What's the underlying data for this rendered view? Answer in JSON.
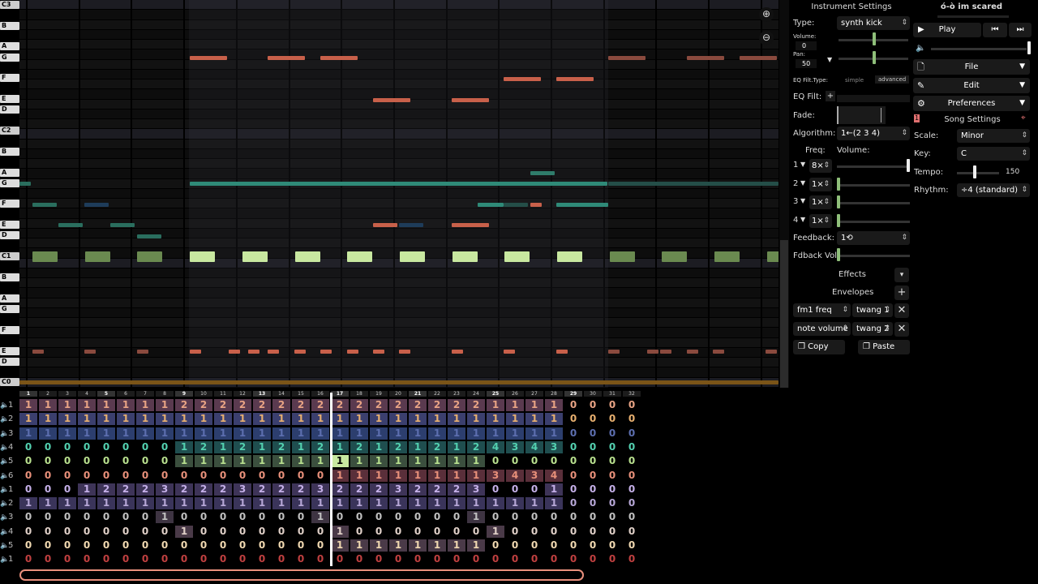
{
  "piano_keys": [
    "C3",
    "B",
    "A",
    "G",
    "F",
    "E",
    "D",
    "C2",
    "B",
    "A",
    "G",
    "F",
    "E",
    "D",
    "C1",
    "B",
    "A",
    "G",
    "F",
    "E",
    "D",
    "C0"
  ],
  "zoom": {
    "in_icon": "zoom-in-icon",
    "out_icon": "zoom-out-icon"
  },
  "bar_numbers": [
    "1",
    "2",
    "3",
    "4",
    "5",
    "6",
    "7",
    "8",
    "9",
    "10",
    "11",
    "12",
    "13",
    "14",
    "15",
    "16",
    "17",
    "18",
    "19",
    "20",
    "21",
    "22",
    "23",
    "24",
    "25",
    "26",
    "27",
    "28",
    "29",
    "30",
    "31",
    "32"
  ],
  "channels": [
    {
      "label": "1",
      "color": "#e8a384",
      "bg": "#5a3a4f",
      "cells": [
        "1",
        "1",
        "1",
        "1",
        "1",
        "1",
        "1",
        "1",
        "2",
        "2",
        "2",
        "2",
        "2",
        "2",
        "2",
        "2",
        "2",
        "2",
        "2",
        "2",
        "2",
        "2",
        "2",
        "2",
        "1",
        "1",
        "1",
        "1",
        "0",
        "0",
        "0",
        "0"
      ]
    },
    {
      "label": "2",
      "color": "#e8b070",
      "bg": "#3b3f6e",
      "cells": [
        "1",
        "1",
        "1",
        "1",
        "1",
        "1",
        "1",
        "1",
        "1",
        "1",
        "1",
        "1",
        "1",
        "1",
        "1",
        "1",
        "1",
        "1",
        "1",
        "1",
        "1",
        "1",
        "1",
        "1",
        "1",
        "1",
        "1",
        "1",
        "0",
        "0",
        "0",
        "0"
      ]
    },
    {
      "label": "3",
      "color": "#5d6fb0",
      "bg": "#2c3e6e",
      "cells": [
        "1",
        "1",
        "1",
        "1",
        "1",
        "1",
        "1",
        "1",
        "1",
        "1",
        "1",
        "1",
        "1",
        "1",
        "1",
        "1",
        "1",
        "1",
        "1",
        "1",
        "1",
        "1",
        "1",
        "1",
        "1",
        "1",
        "1",
        "1",
        "0",
        "0",
        "0",
        "0"
      ]
    },
    {
      "label": "4",
      "color": "#53d1b0",
      "bg": "#1f4e4f",
      "cells": [
        "0",
        "0",
        "0",
        "0",
        "0",
        "0",
        "0",
        "0",
        "1",
        "2",
        "1",
        "2",
        "1",
        "2",
        "1",
        "2",
        "1",
        "2",
        "1",
        "2",
        "1",
        "2",
        "1",
        "2",
        "4",
        "3",
        "4",
        "3",
        "0",
        "0",
        "0",
        "0"
      ]
    },
    {
      "label": "5",
      "color": "#b8e08e",
      "bg": "#3b4f3e",
      "cells": [
        "0",
        "0",
        "0",
        "0",
        "0",
        "0",
        "0",
        "0",
        "1",
        "1",
        "1",
        "1",
        "1",
        "1",
        "1",
        "1",
        "1",
        "1",
        "1",
        "1",
        "1",
        "1",
        "1",
        "1",
        "0",
        "0",
        "0",
        "0",
        "0",
        "0",
        "0",
        "0"
      ]
    },
    {
      "label": "6",
      "color": "#e8907a",
      "bg": "#5a2f3a",
      "cells": [
        "0",
        "0",
        "0",
        "0",
        "0",
        "0",
        "0",
        "0",
        "0",
        "0",
        "0",
        "0",
        "0",
        "0",
        "0",
        "0",
        "1",
        "1",
        "1",
        "1",
        "1",
        "1",
        "1",
        "1",
        "3",
        "4",
        "3",
        "4",
        "0",
        "0",
        "0",
        "0"
      ]
    },
    {
      "label": "1",
      "color": "#c5b0e8",
      "bg": "#3e3458",
      "cells": [
        "0",
        "0",
        "0",
        "1",
        "2",
        "2",
        "2",
        "3",
        "2",
        "2",
        "2",
        "3",
        "2",
        "2",
        "2",
        "3",
        "2",
        "2",
        "2",
        "3",
        "2",
        "2",
        "2",
        "3",
        "0",
        "0",
        "0",
        "1",
        "0",
        "0",
        "0",
        "0"
      ]
    },
    {
      "label": "2",
      "color": "#b8a8d8",
      "bg": "#3a345a",
      "cells": [
        "1",
        "1",
        "1",
        "1",
        "1",
        "1",
        "1",
        "1",
        "1",
        "1",
        "1",
        "1",
        "1",
        "1",
        "1",
        "1",
        "1",
        "1",
        "1",
        "1",
        "1",
        "1",
        "1",
        "1",
        "1",
        "1",
        "1",
        "1",
        "0",
        "0",
        "0",
        "0"
      ]
    },
    {
      "label": "3",
      "color": "#c0c0c0",
      "bg": "#3e3442",
      "cells": [
        "0",
        "0",
        "0",
        "0",
        "0",
        "0",
        "0",
        "1",
        "0",
        "0",
        "0",
        "0",
        "0",
        "0",
        "0",
        "1",
        "0",
        "0",
        "0",
        "0",
        "0",
        "0",
        "0",
        "1",
        "0",
        "0",
        "0",
        "0",
        "0",
        "0",
        "0",
        "0"
      ]
    },
    {
      "label": "4",
      "color": "#e0d0c8",
      "bg": "#4a3a48",
      "cells": [
        "0",
        "0",
        "0",
        "0",
        "0",
        "0",
        "0",
        "0",
        "1",
        "0",
        "0",
        "0",
        "0",
        "0",
        "0",
        "0",
        "1",
        "0",
        "0",
        "0",
        "0",
        "0",
        "0",
        "0",
        "1",
        "0",
        "0",
        "0",
        "0",
        "0",
        "0",
        "0"
      ]
    },
    {
      "label": "5",
      "color": "#f0d8b0",
      "bg": "#4a3a48",
      "cells": [
        "0",
        "0",
        "0",
        "0",
        "0",
        "0",
        "0",
        "0",
        "0",
        "0",
        "0",
        "0",
        "0",
        "0",
        "0",
        "0",
        "1",
        "1",
        "1",
        "1",
        "1",
        "1",
        "1",
        "1",
        "0",
        "0",
        "0",
        "0",
        "0",
        "0",
        "0",
        "0"
      ]
    },
    {
      "label": "1",
      "color": "#c04040",
      "bg": "#000000",
      "cells": [
        "0",
        "0",
        "0",
        "0",
        "0",
        "0",
        "0",
        "0",
        "0",
        "0",
        "0",
        "0",
        "0",
        "0",
        "0",
        "0",
        "0",
        "0",
        "0",
        "0",
        "0",
        "0",
        "0",
        "0",
        "0",
        "0",
        "0",
        "0",
        "0",
        "0",
        "0",
        "0"
      ]
    }
  ],
  "instrument": {
    "title": "Instrument Settings",
    "type_label": "Type:",
    "type_value": "synth kick",
    "volume_label": "Volume:",
    "volume_value": "0",
    "pan_label": "Pan:",
    "pan_value": "50",
    "eq_filt_type_label": "EQ Filt.Type:",
    "eq_simple": "simple",
    "eq_advanced": "advanced",
    "eq_filt_label": "EQ Filt:",
    "eq_add": "+",
    "fade_label": "Fade:",
    "algorithm_label": "Algorithm:",
    "algorithm_value": "1←(2 3 4)",
    "freq_label": "Freq:",
    "op_volume_label": "Volume:",
    "operators": [
      {
        "num": "1",
        "freq": "8×"
      },
      {
        "num": "2",
        "freq": "1×"
      },
      {
        "num": "3",
        "freq": "1×"
      },
      {
        "num": "4",
        "freq": "1×"
      }
    ],
    "feedback_label": "Feedback:",
    "feedback_value": "1⟲",
    "fdback_vol_label": "Fdback Vol:",
    "effects_label": "Effects",
    "envelopes_label": "Envelopes",
    "envelopes": [
      {
        "target": "fm1 freq",
        "shape": "twang 1"
      },
      {
        "target": "note volume",
        "shape": "twang 2"
      }
    ],
    "copy_label": "Copy",
    "paste_label": "Paste"
  },
  "song": {
    "title": "ó-ò im scared",
    "play_label": "Play",
    "file_label": "File",
    "edit_label": "Edit",
    "preferences_label": "Preferences",
    "song_settings_label": "Song Settings",
    "scale_label": "Scale:",
    "scale_value": "Minor",
    "key_label": "Key:",
    "key_value": "C",
    "tempo_label": "Tempo:",
    "tempo_value": "150",
    "rhythm_label": "Rhythm:",
    "rhythm_value": "÷4 (standard)"
  },
  "colors": {
    "accent_green": "#8fbf7a",
    "note_orange": "#e07050",
    "note_teal": "#3aa08a",
    "note_lime": "#c8e8a0",
    "scroll_pink": "#e9907d"
  }
}
